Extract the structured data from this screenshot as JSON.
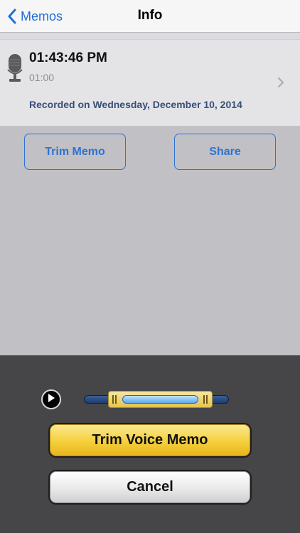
{
  "navbar": {
    "back_label": "Memos",
    "title": "Info",
    "back_icon": "chevron-left-icon"
  },
  "memo": {
    "time": "01:43:46 PM",
    "duration": "01:00",
    "recorded_date": "Recorded on Wednesday, December 10, 2014",
    "icon": "microphone-icon",
    "disclosure_icon": "chevron-right-icon"
  },
  "actions": {
    "trim_label": "Trim Memo",
    "share_label": "Share"
  },
  "trim_panel": {
    "play_icon": "play-icon",
    "selection_start_fraction": 0.17,
    "selection_end_fraction": 0.89,
    "trim_button_label": "Trim Voice Memo",
    "cancel_button_label": "Cancel"
  },
  "colors": {
    "accent": "#1f6fd6",
    "panel_background": "#464649",
    "trim_button": "#f5cf3b"
  }
}
